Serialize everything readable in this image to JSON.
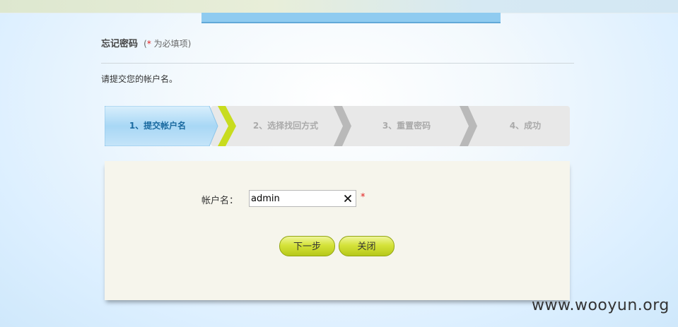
{
  "page": {
    "title": "忘记密码",
    "required_note_open": "(",
    "required_star": "*",
    "required_note_text": "为必填项)",
    "instruction": "请提交您的帐户名。"
  },
  "steps": [
    {
      "label": "1、提交帐户名",
      "state": "active"
    },
    {
      "label": "2、选择找回方式",
      "state": "inactive"
    },
    {
      "label": "3、重置密码",
      "state": "inactive"
    },
    {
      "label": "4、成功",
      "state": "inactive"
    }
  ],
  "form": {
    "account_label": "帐户名：",
    "account_value": "admin",
    "required_star": "*",
    "next_button": "下一步",
    "close_button": "关闭"
  },
  "watermark": "www.wooyun.org",
  "colors": {
    "active_step": "#a8d7f5",
    "active_text": "#1a6aa0",
    "inactive_step": "#e8e8e8",
    "separator_green": "#c8dc1e",
    "separator_gray": "#b9b9b9",
    "button": "#c8d82a"
  }
}
